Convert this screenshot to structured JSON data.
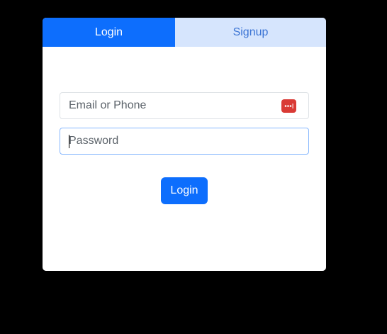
{
  "tabs": {
    "login_label": "Login",
    "signup_label": "Signup"
  },
  "form": {
    "email_placeholder": "Email or Phone",
    "password_placeholder": "Password",
    "submit_label": "Login"
  },
  "icons": {
    "password_manager": "password-manager-icon"
  },
  "colors": {
    "primary": "#0d6efd",
    "tab_inactive_bg": "#d6e5fd",
    "password_manager": "#d93a35"
  }
}
